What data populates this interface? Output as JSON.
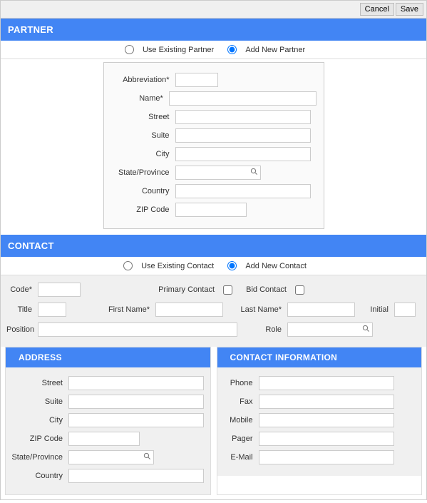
{
  "toolbar": {
    "cancel": "Cancel",
    "save": "Save"
  },
  "partner": {
    "header": "PARTNER",
    "radio_existing": "Use Existing Partner",
    "radio_addnew": "Add New Partner",
    "fields": {
      "abbreviation": "Abbreviation*",
      "name": "Name*",
      "street": "Street",
      "suite": "Suite",
      "city": "City",
      "state": "State/Province",
      "country": "Country",
      "zip": "ZIP Code"
    }
  },
  "contact": {
    "header": "CONTACT",
    "radio_existing": "Use Existing Contact",
    "radio_addnew": "Add New Contact",
    "fields": {
      "code": "Code*",
      "primary": "Primary Contact",
      "bid": "Bid Contact",
      "title": "Title",
      "first": "First Name*",
      "last": "Last Name*",
      "initial": "Initial",
      "position": "Position",
      "role": "Role"
    }
  },
  "address": {
    "header": "ADDRESS",
    "street": "Street",
    "suite": "Suite",
    "city": "City",
    "zip": "ZIP Code",
    "state": "State/Province",
    "country": "Country"
  },
  "cinfo": {
    "header": "CONTACT INFORMATION",
    "phone": "Phone",
    "fax": "Fax",
    "mobile": "Mobile",
    "pager": "Pager",
    "email": "E-Mail"
  }
}
